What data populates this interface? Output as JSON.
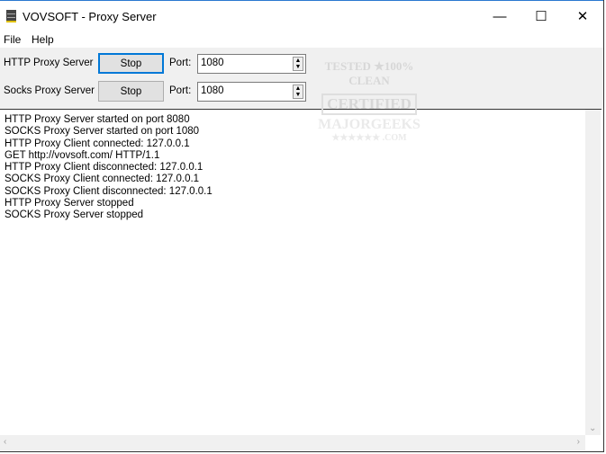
{
  "window": {
    "title": "VOVSOFT - Proxy Server",
    "minimize": "—",
    "maximize": "☐",
    "close": "✕"
  },
  "menu": [
    "File",
    "Help"
  ],
  "http": {
    "label": "HTTP Proxy Server",
    "button": "Stop",
    "port_label": "Port:",
    "port": "1080"
  },
  "socks": {
    "label": "Socks Proxy Server",
    "button": "Stop",
    "port_label": "Port:",
    "port": "1080"
  },
  "watermark": {
    "line1": "TESTED ★100% CLEAN",
    "line2": "CERTIFIED",
    "line3": "MAJORGEEKS",
    "line4": "★★★★★★ .COM"
  },
  "log": [
    "HTTP Proxy Server started on port 8080",
    "SOCKS Proxy Server started on port 1080",
    "HTTP Proxy Client connected: 127.0.0.1",
    "GET http://vovsoft.com/ HTTP/1.1",
    "HTTP Proxy Client disconnected: 127.0.0.1",
    "SOCKS Proxy Client connected: 127.0.0.1",
    "SOCKS Proxy Client disconnected: 127.0.0.1",
    "HTTP Proxy Server stopped",
    "SOCKS Proxy Server stopped"
  ]
}
